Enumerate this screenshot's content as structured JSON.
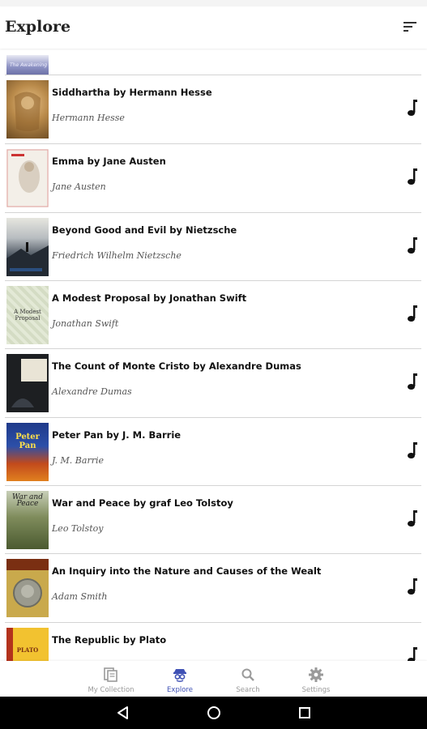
{
  "app_bar": {
    "title": "Explore",
    "sort_icon": "sort-icon"
  },
  "books": [
    {
      "title": "Siddhartha by Hermann Hesse",
      "author": "Hermann Hesse",
      "cover_color": "#b98a4a",
      "cover_text": ""
    },
    {
      "title": "Emma by Jane Austen",
      "author": "Jane Austen",
      "cover_color": "#f3efe8",
      "cover_text": ""
    },
    {
      "title": "Beyond Good and Evil by Nietzsche",
      "author": "Friedrich Wilhelm Nietzsche",
      "cover_color": "#2c3540",
      "cover_text": ""
    },
    {
      "title": "A Modest Proposal by Jonathan Swift",
      "author": "Jonathan Swift",
      "cover_color": "#e3e9d6",
      "cover_text": "A Modest Proposal"
    },
    {
      "title": "The Count of Monte Cristo by Alexandre Dumas",
      "author": "Alexandre Dumas",
      "cover_color": "#1d1f22",
      "cover_text": ""
    },
    {
      "title": "Peter Pan by J. M.  Barrie",
      "author": "J. M. Barrie",
      "cover_color": "#1f3a8a",
      "cover_text": "Peter Pan"
    },
    {
      "title": "War and Peace by graf Leo Tolstoy",
      "author": "Leo Tolstoy",
      "cover_color": "#5a6a3c",
      "cover_text": "War and Peace"
    },
    {
      "title": "An Inquiry into the Nature and Causes of the Wealt",
      "author": "Adam Smith",
      "cover_color": "#c9a94c",
      "cover_text": ""
    },
    {
      "title": "The Republic by Plato",
      "author": "",
      "cover_color": "#f2c230",
      "cover_text": "PLATO"
    }
  ],
  "bottom_nav": [
    {
      "label": "My Collection",
      "icon": "collection-icon",
      "active": false
    },
    {
      "label": "Explore",
      "icon": "explore-icon",
      "active": true
    },
    {
      "label": "Search",
      "icon": "search-icon",
      "active": false
    },
    {
      "label": "Settings",
      "icon": "gear-icon",
      "active": false
    }
  ],
  "colors": {
    "accent": "#3f51b5",
    "inactive": "#9a9a9a",
    "divider": "#d4d4d4"
  }
}
